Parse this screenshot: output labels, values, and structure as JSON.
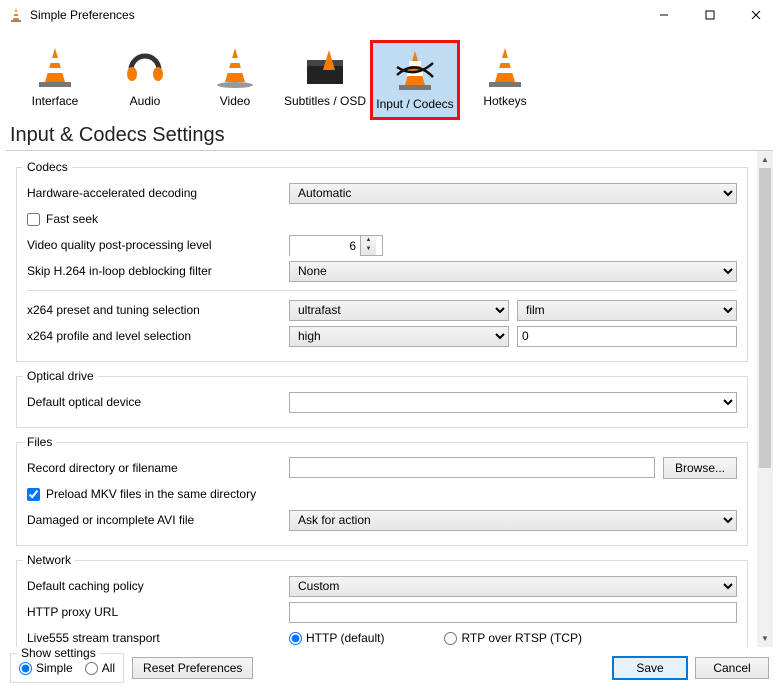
{
  "window": {
    "title": "Simple Preferences"
  },
  "categories": [
    {
      "id": "interface",
      "label": "Interface"
    },
    {
      "id": "audio",
      "label": "Audio"
    },
    {
      "id": "video",
      "label": "Video"
    },
    {
      "id": "subtitles",
      "label": "Subtitles / OSD"
    },
    {
      "id": "input-codecs",
      "label": "Input / Codecs",
      "selected": true
    },
    {
      "id": "hotkeys",
      "label": "Hotkeys"
    }
  ],
  "heading": "Input & Codecs Settings",
  "groups": {
    "codecs": {
      "legend": "Codecs",
      "hw_decoding_label": "Hardware-accelerated decoding",
      "hw_decoding_value": "Automatic",
      "fast_seek_label": "Fast seek",
      "fast_seek_checked": false,
      "pp_level_label": "Video quality post-processing level",
      "pp_level_value": "6",
      "skip_loop_label": "Skip H.264 in-loop deblocking filter",
      "skip_loop_value": "None",
      "x264_preset_label": "x264 preset and tuning selection",
      "x264_preset_value": "ultrafast",
      "x264_tune_value": "film",
      "x264_profile_label": "x264 profile and level selection",
      "x264_profile_value": "high",
      "x264_level_value": "0"
    },
    "optical": {
      "legend": "Optical drive",
      "default_device_label": "Default optical device",
      "default_device_value": ""
    },
    "files": {
      "legend": "Files",
      "record_dir_label": "Record directory or filename",
      "record_dir_value": "",
      "browse_label": "Browse...",
      "preload_mkv_label": "Preload MKV files in the same directory",
      "preload_mkv_checked": true,
      "damaged_avi_label": "Damaged or incomplete AVI file",
      "damaged_avi_value": "Ask for action"
    },
    "network": {
      "legend": "Network",
      "caching_label": "Default caching policy",
      "caching_value": "Custom",
      "proxy_label": "HTTP proxy URL",
      "proxy_value": "",
      "live555_label": "Live555 stream transport",
      "live555_http_label": "HTTP (default)",
      "live555_rtp_label": "RTP over RTSP (TCP)",
      "live555_selected": "http"
    }
  },
  "footer": {
    "show_settings_legend": "Show settings",
    "simple_label": "Simple",
    "all_label": "All",
    "mode": "simple",
    "reset_label": "Reset Preferences",
    "save_label": "Save",
    "cancel_label": "Cancel"
  }
}
